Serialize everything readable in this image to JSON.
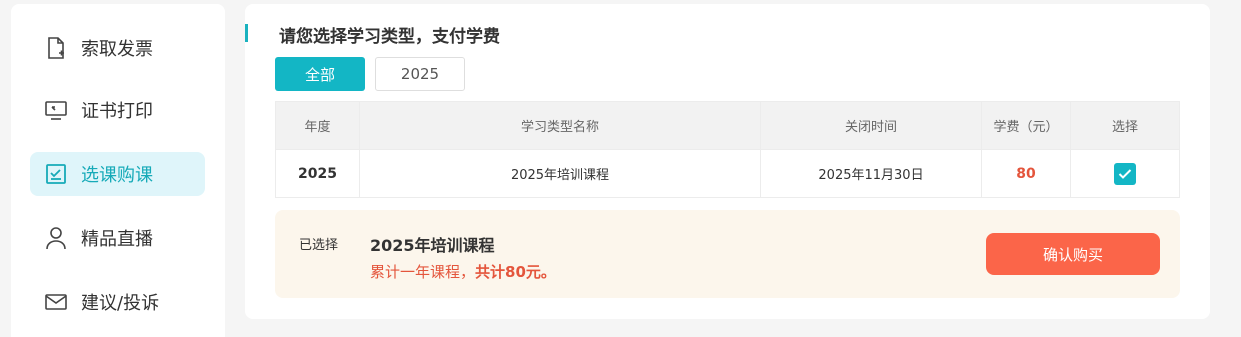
{
  "sidebar": {
    "items": [
      {
        "label": "索取发票",
        "icon": "invoice-icon"
      },
      {
        "label": "证书打印",
        "icon": "certificate-print-icon"
      },
      {
        "label": "选课购课",
        "icon": "course-select-icon"
      },
      {
        "label": "精品直播",
        "icon": "user-icon"
      },
      {
        "label": "建议/投诉",
        "icon": "mail-icon"
      }
    ],
    "active_index": 2
  },
  "main": {
    "title": "请您选择学习类型，支付学费",
    "tabs": [
      {
        "label": "全部",
        "active": true
      },
      {
        "label": "2025",
        "active": false
      }
    ],
    "table": {
      "headers": [
        "年度",
        "学习类型名称",
        "关闭时间",
        "学费（元）",
        "选择"
      ],
      "rows": [
        {
          "year": "2025",
          "name": "2025年培训课程",
          "close_time": "2025年11月30日",
          "fee": "80",
          "selected": true
        }
      ]
    },
    "summary": {
      "selected_label": "已选择",
      "course_name": "2025年培训课程",
      "desc_prefix": "累计一年课程，",
      "desc_total": "共计80元。",
      "confirm_label": "确认购买"
    }
  },
  "colors": {
    "accent": "#13b6c5",
    "fee": "#e4553c",
    "confirm": "#fb6549",
    "summary_bg": "#fcf6ec",
    "active_nav_bg": "#dff5fa"
  }
}
